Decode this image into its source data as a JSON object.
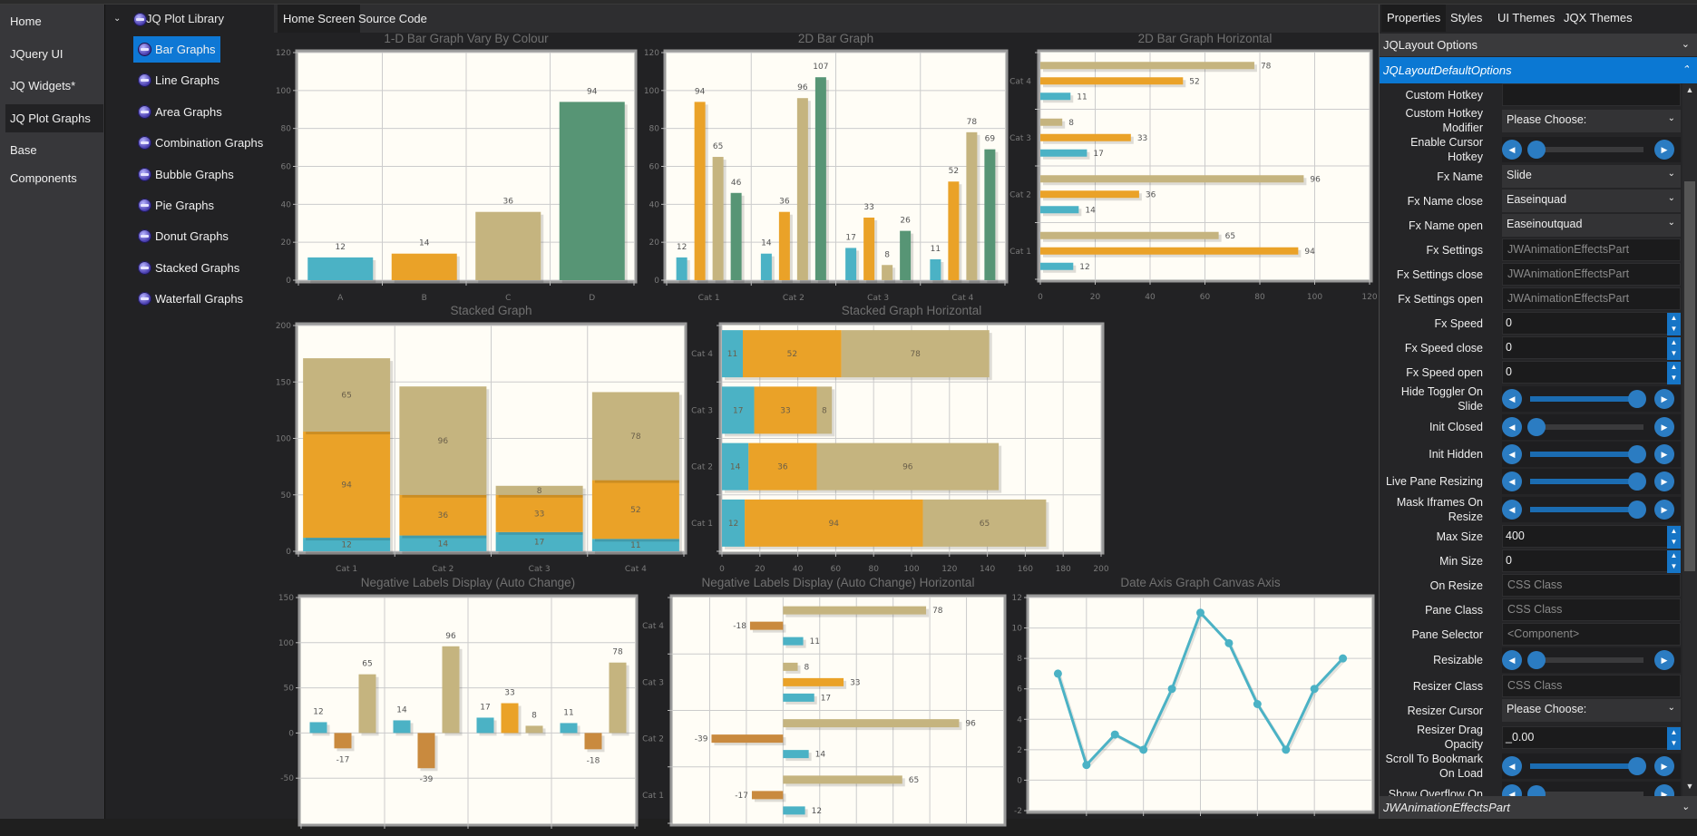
{
  "nav": {
    "items": [
      {
        "label": "Home",
        "selected": false
      },
      {
        "label": "JQuery UI",
        "selected": false
      },
      {
        "label": "JQ Widgets*",
        "selected": false
      },
      {
        "label": "JQ Plot Graphs",
        "selected": true
      },
      {
        "label": "Base Components",
        "selected": false
      }
    ]
  },
  "tree": {
    "root": "JQ Plot Library",
    "items": [
      {
        "label": "Bar Graphs",
        "selected": true
      },
      {
        "label": "Line Graphs"
      },
      {
        "label": "Area Graphs"
      },
      {
        "label": "Combination Graphs"
      },
      {
        "label": "Bubble Graphs"
      },
      {
        "label": "Pie Graphs"
      },
      {
        "label": "Donut Graphs"
      },
      {
        "label": "Stacked Graphs"
      },
      {
        "label": "Waterfall Graphs"
      }
    ]
  },
  "main": {
    "tabs": [
      {
        "label": "Home Screen",
        "active": true
      },
      {
        "label": "Source Code",
        "active": false
      }
    ]
  },
  "chart_data": [
    {
      "type": "bar",
      "title": "1-D Bar Graph Vary By Colour",
      "categories": [
        "A",
        "B",
        "C",
        "D"
      ],
      "series": [
        {
          "values": [
            12,
            14,
            36,
            94
          ],
          "colors": [
            "#4bb2c5",
            "#eaa228",
            "#c5b47f",
            "#579575"
          ]
        }
      ],
      "ylim": [
        0,
        120
      ],
      "yticks": [
        0,
        20,
        40,
        60,
        80,
        100,
        120
      ],
      "point_labels": true,
      "grid": true
    },
    {
      "type": "bar",
      "title": "2D Bar Graph",
      "categories": [
        "Cat 1",
        "Cat 2",
        "Cat 3",
        "Cat 4"
      ],
      "series": [
        {
          "values": [
            12,
            14,
            17,
            11
          ],
          "color": "#4bb2c5"
        },
        {
          "values": [
            94,
            36,
            33,
            52
          ],
          "color": "#eaa228"
        },
        {
          "values": [
            65,
            96,
            8,
            78
          ],
          "color": "#c5b47f"
        },
        {
          "values": [
            46,
            107,
            26,
            69
          ],
          "color": "#579575"
        }
      ],
      "ylim": [
        0,
        120
      ],
      "yticks": [
        0,
        20,
        40,
        60,
        80,
        100,
        120
      ],
      "point_labels": true,
      "grid": true
    },
    {
      "type": "hbar",
      "title": "2D Bar Graph Horizontal",
      "categories": [
        "Cat 1",
        "Cat 2",
        "Cat 3",
        "Cat 4"
      ],
      "series": [
        {
          "values": [
            12,
            14,
            17,
            11
          ],
          "color": "#4bb2c5"
        },
        {
          "values": [
            94,
            36,
            33,
            52
          ],
          "color": "#eaa228"
        },
        {
          "values": [
            65,
            96,
            8,
            78
          ],
          "color": "#c5b47f"
        }
      ],
      "xlim": [
        0,
        120
      ],
      "xticks": [
        0,
        20,
        40,
        60,
        80,
        100,
        120
      ],
      "point_labels": true,
      "grid": true
    },
    {
      "type": "stacked-bar",
      "title": "Stacked Graph",
      "categories": [
        "Cat 1",
        "Cat 2",
        "Cat 3",
        "Cat 4"
      ],
      "series": [
        {
          "values": [
            12,
            14,
            17,
            11
          ],
          "color": "#4bb2c5"
        },
        {
          "values": [
            94,
            36,
            33,
            52
          ],
          "color": "#eaa228"
        },
        {
          "values": [
            65,
            96,
            8,
            78
          ],
          "color": "#c5b47f"
        }
      ],
      "ylim": [
        0,
        200
      ],
      "yticks": [
        0,
        50,
        100,
        150,
        200
      ],
      "point_labels": true,
      "grid": true
    },
    {
      "type": "stacked-hbar",
      "title": "Stacked Graph Horizontal",
      "categories": [
        "Cat 1",
        "Cat 2",
        "Cat 3",
        "Cat 4"
      ],
      "series": [
        {
          "values": [
            12,
            14,
            17,
            11
          ],
          "color": "#4bb2c5"
        },
        {
          "values": [
            94,
            36,
            33,
            52
          ],
          "color": "#eaa228"
        },
        {
          "values": [
            65,
            96,
            8,
            78
          ],
          "color": "#c5b47f"
        }
      ],
      "xlim": [
        0,
        200
      ],
      "xticks": [
        0,
        20,
        40,
        60,
        80,
        100,
        120,
        140,
        160,
        180,
        200
      ],
      "point_labels": true,
      "grid": true
    },
    {
      "type": "bar",
      "title": "Negative Labels Display (Auto Change)",
      "series": [
        {
          "values": [
            12,
            14,
            17,
            11
          ],
          "color": "#4bb2c5"
        },
        {
          "values": [
            -17,
            -39,
            33,
            -18
          ],
          "color": "#eaa228"
        },
        {
          "values": [
            65,
            96,
            8,
            78
          ],
          "color": "#c5b47f"
        }
      ],
      "negative_color": "#c98a3e",
      "ylim": [
        -100,
        150
      ],
      "yticks": [
        -50,
        0,
        50,
        100,
        150
      ],
      "point_labels": true,
      "grid": true
    },
    {
      "type": "hbar",
      "title": "Negative Labels Display (Auto Change) Horizontal",
      "categories": [
        "Cat 1",
        "Cat 2",
        "Cat 3",
        "Cat 4"
      ],
      "series": [
        {
          "values": [
            12,
            14,
            17,
            11
          ],
          "color": "#4bb2c5"
        },
        {
          "values": [
            -17,
            -39,
            33,
            -18
          ],
          "color": "#eaa228"
        },
        {
          "values": [
            65,
            96,
            8,
            78
          ],
          "color": "#c5b47f"
        }
      ],
      "negative_color": "#c98a3e",
      "xlim": [
        -60,
        120
      ],
      "xgrid": [
        -40,
        -20,
        0,
        20,
        40,
        60,
        80,
        100
      ],
      "point_labels": true,
      "grid": true
    },
    {
      "type": "line",
      "title": "Date Axis Graph Canvas Axis",
      "series": [
        {
          "values": [
            7,
            1,
            3,
            2,
            6,
            11,
            9,
            5,
            2,
            6,
            8
          ],
          "color": "#4bb2c5"
        }
      ],
      "ylim": [
        -2,
        12
      ],
      "yticks": [
        -2,
        0,
        2,
        4,
        6,
        8,
        10,
        12
      ],
      "grid": true
    }
  ],
  "props": {
    "tabs": [
      {
        "label": "Properties",
        "active": true
      },
      {
        "label": "Styles"
      },
      {
        "label": "UI Themes"
      },
      {
        "label": "JQX Themes"
      }
    ],
    "section": "JQLayout Options",
    "subsection": "JQLayoutDefaultOptions",
    "footer_section": "JWAnimationEffectsPart",
    "rows": [
      {
        "label": "Custom Hotkey",
        "type": "input",
        "value": ""
      },
      {
        "label": "Custom Hotkey Modifier",
        "type": "select",
        "value": "Please Choose:"
      },
      {
        "label": "Enable Cursor Hotkey",
        "type": "toggle",
        "on": false
      },
      {
        "label": "Fx Name",
        "type": "select",
        "value": "Slide"
      },
      {
        "label": "Fx Name close",
        "type": "select",
        "value": "Easeinquad"
      },
      {
        "label": "Fx Name open",
        "type": "select",
        "value": "Easeinoutquad"
      },
      {
        "label": "Fx Settings",
        "type": "input",
        "placeholder": "JWAnimationEffectsPart"
      },
      {
        "label": "Fx Settings close",
        "type": "input",
        "placeholder": "JWAnimationEffectsPart"
      },
      {
        "label": "Fx Settings open",
        "type": "input",
        "placeholder": "JWAnimationEffectsPart"
      },
      {
        "label": "Fx Speed",
        "type": "spinner",
        "value": "0"
      },
      {
        "label": "Fx Speed close",
        "type": "spinner",
        "value": "0"
      },
      {
        "label": "Fx Speed open",
        "type": "spinner",
        "value": "0"
      },
      {
        "label": "Hide Toggler On Slide",
        "type": "toggle",
        "on": true
      },
      {
        "label": "Init Closed",
        "type": "toggle",
        "on": false
      },
      {
        "label": "Init Hidden",
        "type": "toggle",
        "on": true
      },
      {
        "label": "Live Pane Resizing",
        "type": "toggle",
        "on": true
      },
      {
        "label": "Mask Iframes On Resize",
        "type": "toggle",
        "on": true
      },
      {
        "label": "Max Size",
        "type": "spinner",
        "value": "400"
      },
      {
        "label": "Min Size",
        "type": "spinner",
        "value": "0"
      },
      {
        "label": "On Resize",
        "type": "input",
        "placeholder": "CSS Class"
      },
      {
        "label": "Pane Class",
        "type": "input",
        "placeholder": "CSS Class"
      },
      {
        "label": "Pane Selector",
        "type": "input",
        "placeholder": "<Component>"
      },
      {
        "label": "Resizable",
        "type": "toggle",
        "on": false
      },
      {
        "label": "Resizer Class",
        "type": "input",
        "placeholder": "CSS Class"
      },
      {
        "label": "Resizer Cursor",
        "type": "select",
        "value": "Please Choose:"
      },
      {
        "label": "Resizer Drag Opacity",
        "type": "spinner",
        "value": "_0.00"
      },
      {
        "label": "Scroll To Bookmark On Load",
        "type": "toggle",
        "on": true
      },
      {
        "label": "Show Overflow On",
        "type": "toggle",
        "on": false
      }
    ]
  },
  "colors": {
    "accent": "#0b78d3",
    "plot_bg": "#fffdf6"
  }
}
